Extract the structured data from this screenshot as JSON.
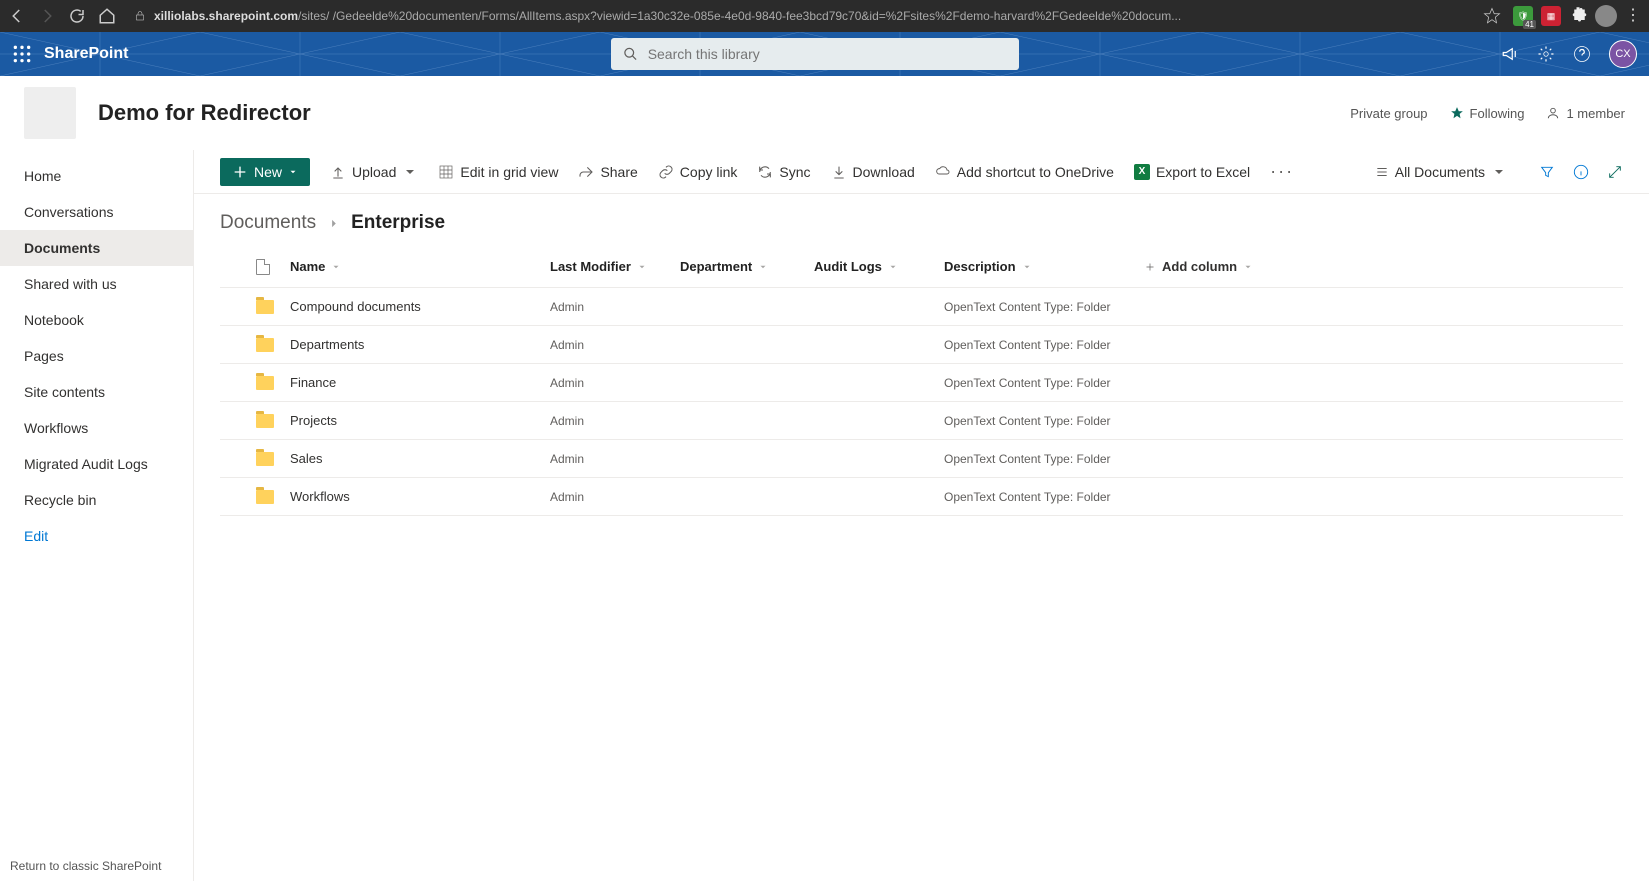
{
  "browser": {
    "url_host": "xilliolabs.sharepoint.com",
    "url_path": "/sites/            /Gedeelde%20documenten/Forms/AllItems.aspx?viewid=1a30c32e-085e-4e0d-9840-fee3bcd79c70&id=%2Fsites%2Fdemo-harvard%2FGedeelde%20docum..."
  },
  "suite": {
    "app_name": "SharePoint",
    "search_placeholder": "Search this library",
    "avatar_initials": "CX"
  },
  "site": {
    "title": "Demo for Redirector",
    "privacy": "Private group",
    "following": "Following",
    "members": "1 member"
  },
  "sidebar": {
    "items": [
      "Home",
      "Conversations",
      "Documents",
      "Shared with us",
      "Notebook",
      "Pages",
      "Site contents",
      "Workflows",
      "Migrated Audit Logs",
      "Recycle bin"
    ],
    "active_index": 2,
    "edit": "Edit",
    "footer": "Return to classic SharePoint"
  },
  "commands": {
    "new": "New",
    "upload": "Upload",
    "edit_grid": "Edit in grid view",
    "share": "Share",
    "copy_link": "Copy link",
    "sync": "Sync",
    "download": "Download",
    "shortcut": "Add shortcut to OneDrive",
    "export": "Export to Excel",
    "view_label": "All Documents"
  },
  "breadcrumb": {
    "root": "Documents",
    "current": "Enterprise"
  },
  "columns": {
    "name": "Name",
    "last_modifier": "Last Modifier",
    "department": "Department",
    "audit_logs": "Audit Logs",
    "description": "Description",
    "add_column": "Add column"
  },
  "rows": [
    {
      "name": "Compound documents",
      "modifier": "Admin",
      "description": "OpenText Content Type: Folder"
    },
    {
      "name": "Departments",
      "modifier": "Admin",
      "description": "OpenText Content Type: Folder"
    },
    {
      "name": "Finance",
      "modifier": "Admin",
      "description": "OpenText Content Type: Folder"
    },
    {
      "name": "Projects",
      "modifier": "Admin",
      "description": "OpenText Content Type: Folder"
    },
    {
      "name": "Sales",
      "modifier": "Admin",
      "description": "OpenText Content Type: Folder"
    },
    {
      "name": "Workflows",
      "modifier": "Admin",
      "description": "OpenText Content Type: Folder"
    }
  ]
}
